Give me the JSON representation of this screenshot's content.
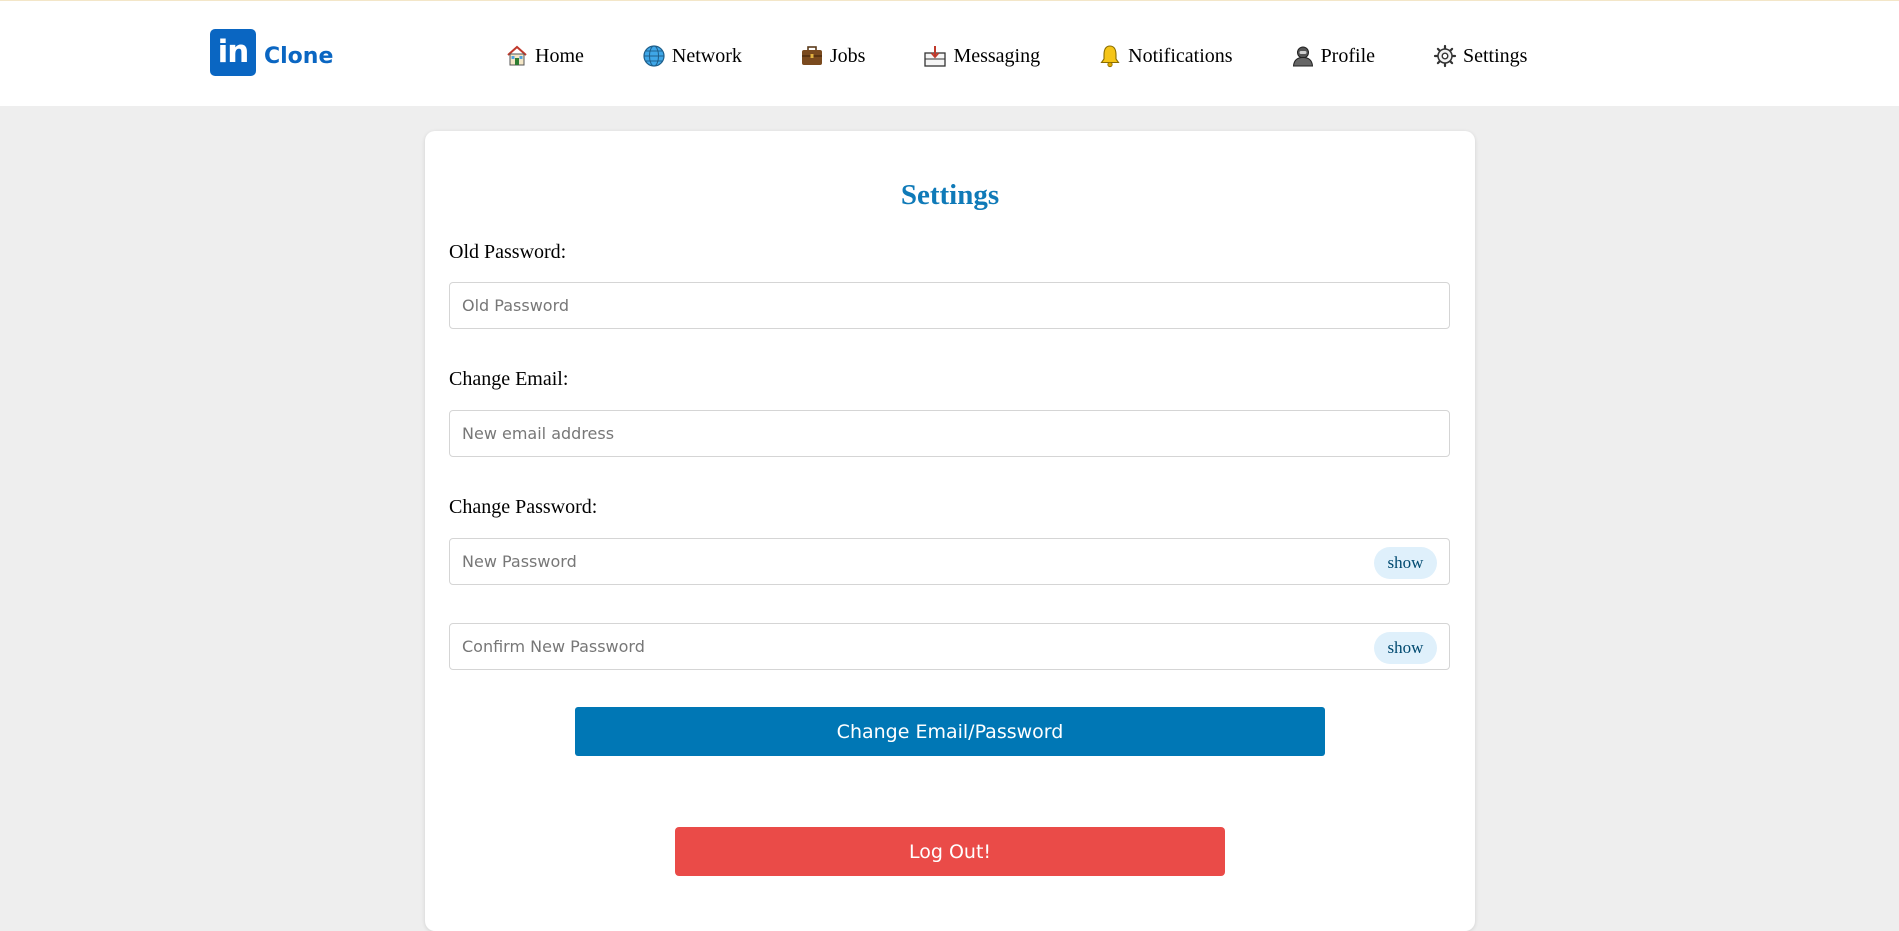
{
  "brand": {
    "logo_mark": "in",
    "name": "Clone",
    "color": "#0a66c2"
  },
  "nav": {
    "items": [
      {
        "label": "Home",
        "icon": "house-icon"
      },
      {
        "label": "Network",
        "icon": "globe-icon"
      },
      {
        "label": "Jobs",
        "icon": "briefcase-icon"
      },
      {
        "label": "Messaging",
        "icon": "inbox-icon"
      },
      {
        "label": "Notifications",
        "icon": "bell-icon"
      },
      {
        "label": "Profile",
        "icon": "user-icon"
      },
      {
        "label": "Settings",
        "icon": "gear-icon"
      }
    ]
  },
  "settings": {
    "title": "Settings",
    "old_password": {
      "label": "Old Password:",
      "placeholder": "Old Password",
      "value": ""
    },
    "change_email": {
      "label": "Change Email:",
      "placeholder": "New email address",
      "value": ""
    },
    "change_password": {
      "label": "Change Password:",
      "new": {
        "placeholder": "New Password",
        "toggle": "show",
        "value": ""
      },
      "confirm": {
        "placeholder": "Confirm New Password",
        "toggle": "show",
        "value": ""
      }
    },
    "submit_label": "Change Email/Password",
    "logout_label": "Log Out!"
  },
  "colors": {
    "accent": "#0077b5",
    "title": "#0f7ab8",
    "danger": "#ea4b48",
    "page_bg": "#eeeeee"
  }
}
